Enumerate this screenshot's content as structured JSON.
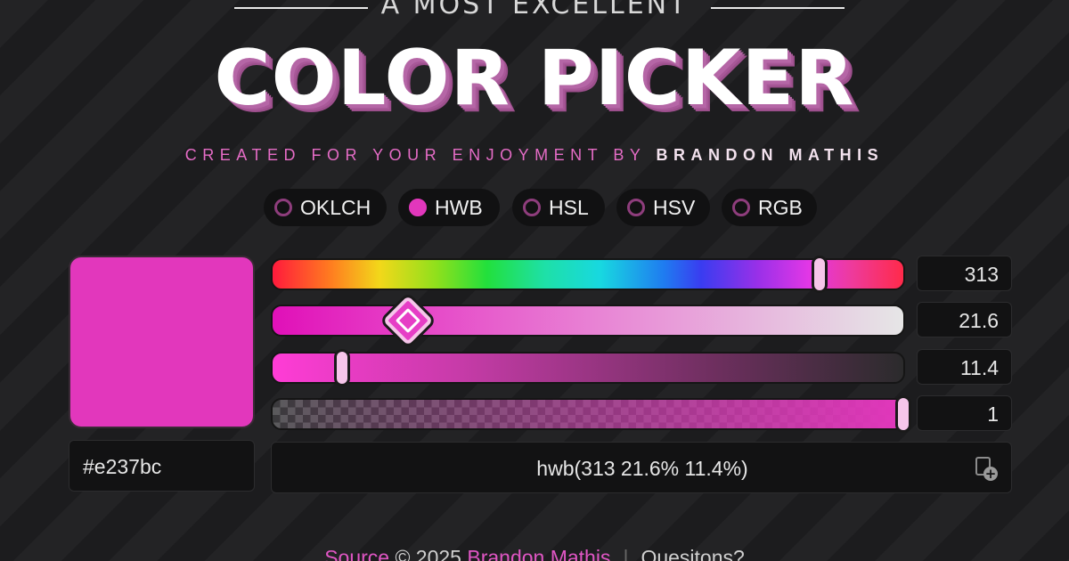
{
  "header": {
    "eyebrow": "A MOST EXCELLENT",
    "title": "COLOR PICKER",
    "credit_prefix": "CREATED FOR YOUR ENJOYMENT BY ",
    "credit_author": "BRANDON MATHIS"
  },
  "modes": [
    {
      "label": "OKLCH",
      "selected": false
    },
    {
      "label": "HWB",
      "selected": true
    },
    {
      "label": "HSL",
      "selected": false
    },
    {
      "label": "HSV",
      "selected": false
    },
    {
      "label": "RGB",
      "selected": false
    }
  ],
  "color": {
    "hex": "#e237bc",
    "output": "hwb(313 21.6% 11.4%)"
  },
  "channels": {
    "hue": {
      "value": "313",
      "fraction": 0.87
    },
    "whiteness": {
      "value": "21.6",
      "fraction": 0.216
    },
    "blackness": {
      "value": "11.4",
      "fraction": 0.114
    },
    "alpha": {
      "value": "1",
      "fraction": 1.0
    }
  },
  "icons": {
    "hex_copy": "copy-icon",
    "output_copy": "copy-icon"
  },
  "footer": {
    "source_link": "Source",
    "copyright": " © 2025 ",
    "author_link": "Brandon Mathis",
    "divider": "|",
    "questions": "Quesitons?"
  },
  "colors": {
    "accent": "#e237bc",
    "background": "#1f1f21",
    "thumb": "#f6c5ea"
  }
}
